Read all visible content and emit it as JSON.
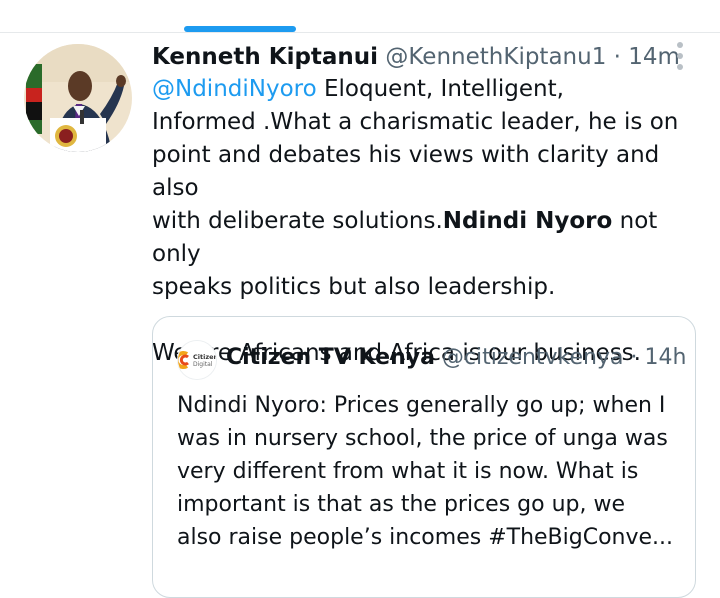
{
  "tweet": {
    "author_name": "Kenneth Kiptanui",
    "handle": "@KennethKiptanu1",
    "time": "· 14m",
    "mention": "@NdindiNyoro",
    "text_part1": " Eloquent, Intelligent,",
    "text_line2": "Informed .What a charismatic leader, he is on",
    "text_line3": "point and debates his views with clarity and also",
    "text_line4_a": "with deliberate solutions.",
    "text_line4_bold": "Ndindi Nyoro",
    "text_line4_b": " not only",
    "text_line5": "speaks politics but also leadership.",
    "text_line7": "We are Africans and Africa is our business.",
    "icons": {
      "more": "more-options-icon",
      "avatar": "author-avatar"
    }
  },
  "quoted_tweet": {
    "author_name": "Citizen TV Kenya",
    "handle": "@citizentvkenya",
    "time": "· 14h",
    "avatar_logo_text": "Citizen Digital",
    "lines": [
      "Ndindi Nyoro: Prices generally go up; when I",
      "was in nursery school, the price of unga was",
      "very different from what it is now. What is",
      "important is that as the prices go up, we",
      "also raise people’s incomes #TheBigConve..."
    ]
  },
  "colors": {
    "accent": "#1d9bf0",
    "text": "#0f1419",
    "muted": "#536471",
    "border": "#cfd9de"
  }
}
